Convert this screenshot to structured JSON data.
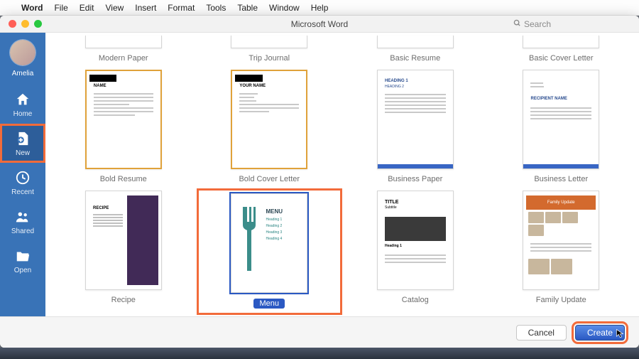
{
  "menubar": {
    "app": "Word",
    "items": [
      "File",
      "Edit",
      "View",
      "Insert",
      "Format",
      "Tools",
      "Table",
      "Window",
      "Help"
    ]
  },
  "window": {
    "title": "Microsoft Word",
    "search_placeholder": "Search"
  },
  "sidebar": {
    "user": "Amelia",
    "items": [
      {
        "id": "home",
        "label": "Home"
      },
      {
        "id": "new",
        "label": "New"
      },
      {
        "id": "recent",
        "label": "Recent"
      },
      {
        "id": "shared",
        "label": "Shared"
      },
      {
        "id": "open",
        "label": "Open"
      }
    ],
    "active": "new"
  },
  "gallery": {
    "row0": [
      {
        "label": "Modern Paper"
      },
      {
        "label": "Trip Journal"
      },
      {
        "label": "Basic Resume"
      },
      {
        "label": "Basic Cover Letter"
      }
    ],
    "templates": [
      {
        "label": "Bold Resume",
        "preview": {
          "name": "NAME",
          "frame": "orange",
          "blackHeader": true
        }
      },
      {
        "label": "Bold Cover Letter",
        "preview": {
          "name": "YOUR NAME",
          "frame": "orange",
          "blackHeader": true
        }
      },
      {
        "label": "Business Paper",
        "preview": {
          "heading1": "HEADING 1",
          "heading2": "HEADING 2",
          "blueBottom": true
        }
      },
      {
        "label": "Business Letter",
        "preview": {
          "recipient": "RECIPIENT NAME",
          "blueBottom": true
        }
      },
      {
        "label": "Recipe",
        "preview": {
          "title": "RECIPE"
        }
      },
      {
        "label": "Menu",
        "preview": {
          "title": "MENU",
          "headings": [
            "Heading 1",
            "Heading 2",
            "Heading 3",
            "Heading 4"
          ]
        },
        "selected": true
      },
      {
        "label": "Catalog",
        "preview": {
          "title": "TITLE",
          "subtitle": "Subtitle",
          "heading": "Heading 1"
        }
      },
      {
        "label": "Family Update",
        "preview": {
          "banner": "Family Update"
        }
      }
    ],
    "selected_label": "Menu"
  },
  "footer": {
    "cancel": "Cancel",
    "create": "Create"
  },
  "menu_preview": {
    "title": "MENU",
    "h1": "Heading 1",
    "h2": "Heading 2",
    "h3": "Heading 3",
    "h4": "Heading 4"
  },
  "bp_preview": {
    "h1": "HEADING 1",
    "h2": "HEADING 2"
  },
  "bl_preview": {
    "recipient": "RECIPIENT NAME"
  },
  "br_preview": {
    "name": "NAME"
  },
  "bcl_preview": {
    "name": "YOUR NAME"
  },
  "cat_preview": {
    "title": "TITLE",
    "sub": "Subtitle",
    "head": "Heading 1"
  },
  "fam_preview": {
    "banner": "Family Update"
  },
  "rec_preview": {
    "title": "RECIPE"
  }
}
